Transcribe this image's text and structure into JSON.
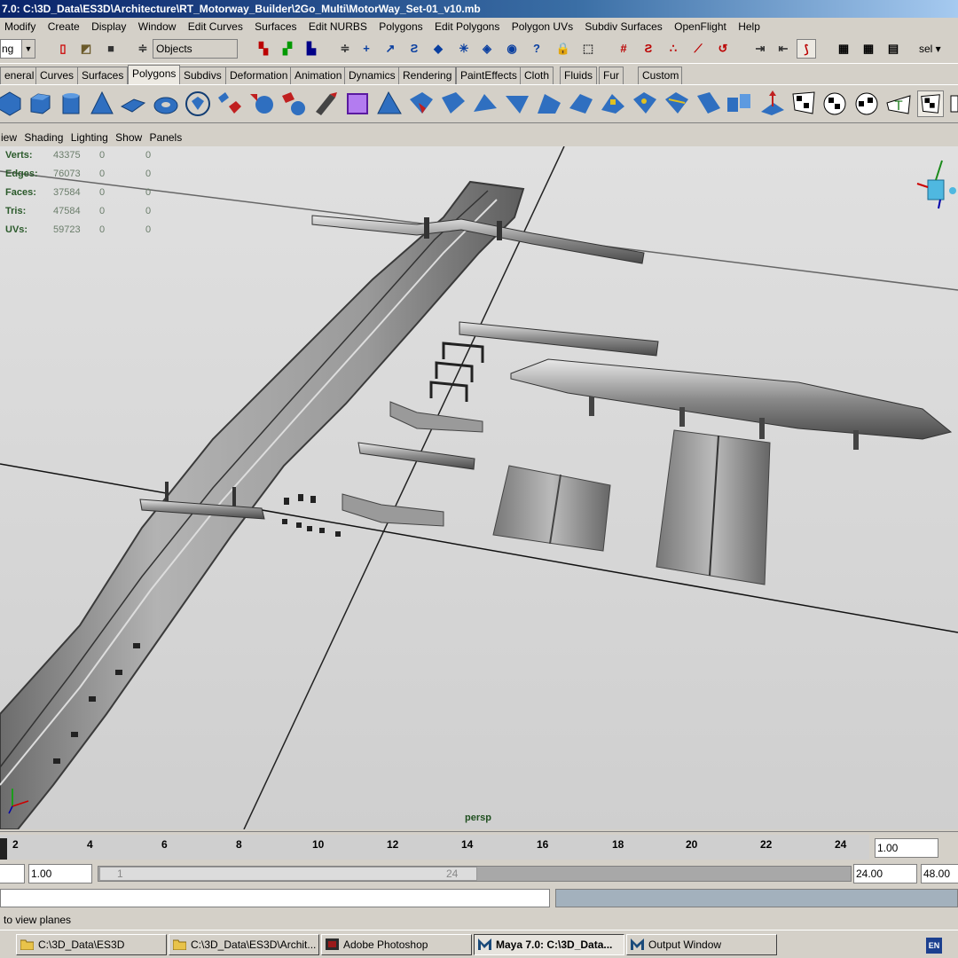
{
  "window": {
    "title": "7.0: C:\\3D_Data\\ES3D\\Architecture\\RT_Motorway_Builder\\2Go_Multi\\MotorWay_Set-01_v10.mb"
  },
  "menubar": [
    "Modify",
    "Create",
    "Display",
    "Window",
    "Edit Curves",
    "Surfaces",
    "Edit NURBS",
    "Polygons",
    "Edit Polygons",
    "Polygon UVs",
    "Subdiv Surfaces",
    "OpenFlight",
    "Help"
  ],
  "statusline": {
    "mode_value": "ng",
    "selection_mask": "Objects",
    "select_field": "sel"
  },
  "shelf": {
    "tabs": [
      "eneral",
      "Curves",
      "Surfaces",
      "Polygons",
      "Subdivs",
      "Deformation",
      "Animation",
      "Dynamics",
      "Rendering",
      "PaintEffects",
      "Cloth",
      "Fluids",
      "Fur",
      "Custom"
    ],
    "active_tab": "Polygons",
    "icons": [
      "poly-sphere-icon",
      "poly-cube-icon",
      "poly-cylinder-icon",
      "poly-cone-icon",
      "poly-plane-icon",
      "poly-torus-icon",
      "poly-pipe-icon",
      "combine-icon",
      "separate-icon",
      "extract-icon",
      "smooth-icon",
      "paint-icon",
      "cube-wireframe-icon",
      "create-polygon-icon",
      "append-polygon-icon",
      "split-polygon-icon",
      "extrude-face-icon",
      "extrude-edge-icon",
      "bevel-icon",
      "wedge-icon",
      "duplicate-face-icon",
      "merge-vertices-icon",
      "collapse-icon",
      "merge-edge-icon",
      "transfer-icon",
      "planar-map-icon",
      "cylindrical-map-icon",
      "spherical-map-icon",
      "automatic-map-icon",
      "checker-icon"
    ]
  },
  "panel": {
    "menus": [
      "iew",
      "Shading",
      "Lighting",
      "Show",
      "Panels"
    ],
    "camera_label": "persp",
    "hud": [
      {
        "label": "Verts:",
        "value": "43375",
        "z1": "0",
        "z2": "0"
      },
      {
        "label": "Edges:",
        "value": "76073",
        "z1": "0",
        "z2": "0"
      },
      {
        "label": "Faces:",
        "value": "37584",
        "z1": "0",
        "z2": "0"
      },
      {
        "label": "Tris:",
        "value": "47584",
        "z1": "0",
        "z2": "0"
      },
      {
        "label": "UVs:",
        "value": "59723",
        "z1": "0",
        "z2": "0"
      }
    ]
  },
  "timeslider": {
    "ticks": [
      "2",
      "4",
      "6",
      "8",
      "10",
      "12",
      "14",
      "16",
      "18",
      "20",
      "22",
      "24"
    ],
    "current_time": "1.00"
  },
  "rangeslider": {
    "start_time": "1.00",
    "range_start": "1",
    "range_end": "24",
    "end_time": "24.00",
    "anim_end": "48.00"
  },
  "helpline": {
    "text": "to view planes"
  },
  "taskbar": [
    {
      "label": "C:\\3D_Data\\ES3D",
      "icon": "folder-icon",
      "active": false
    },
    {
      "label": "C:\\3D_Data\\ES3D\\Archit...",
      "icon": "folder-icon",
      "active": false
    },
    {
      "label": "Adobe Photoshop",
      "icon": "photoshop-icon",
      "active": false
    },
    {
      "label": "Maya 7.0: C:\\3D_Data...",
      "icon": "maya-icon",
      "active": true
    },
    {
      "label": "Output Window",
      "icon": "maya-icon",
      "active": false
    }
  ],
  "tray": {
    "language": "EN"
  },
  "colors": {
    "titlebar": "#0a246a",
    "viewport": "#d6d6d6",
    "shelf_blue": "#2f6fc0"
  }
}
